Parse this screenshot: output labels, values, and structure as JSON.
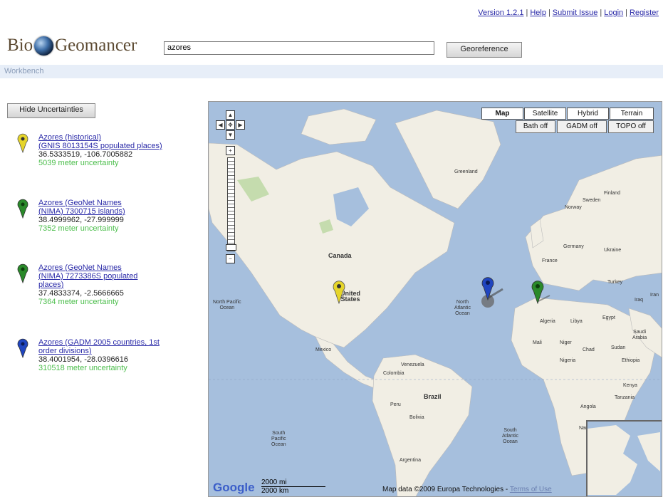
{
  "header": {
    "links": [
      "Version 1.2.1",
      "Help",
      "Submit Issue",
      "Login",
      "Register"
    ],
    "logo_left": "Bio",
    "logo_right": "Geomancer",
    "search_value": "azores",
    "georeference_label": "Georeference"
  },
  "workbench_label": "Workbench",
  "hide_uncertainties_label": "Hide Uncertainties",
  "results": [
    {
      "title_line1": "Azores (historical)",
      "title_line2": "(GNIS 8013154S populated places)",
      "title_line3": "",
      "coords": "36.5333519, -106.7005882",
      "uncertainty": "5039 meter uncertainty",
      "pin_color": "#e6d52a"
    },
    {
      "title_line1": "Azores (GeoNet Names",
      "title_line2": "(NIMA) 7300715 islands)",
      "title_line3": "",
      "coords": "38.4999962, -27.999999",
      "uncertainty": "7352 meter uncertainty",
      "pin_color": "#2a8a2a"
    },
    {
      "title_line1": "Azores (GeoNet Names",
      "title_line2": "(NIMA) 7273386S populated",
      "title_line3": "places)",
      "coords": "37.4833374, -2.5666665",
      "uncertainty": "7364 meter uncertainty",
      "pin_color": "#2a8a2a"
    },
    {
      "title_line1": "Azores (GADM 2005 countries, 1st",
      "title_line2": "order divisions)",
      "title_line3": "",
      "coords": "38.4001954, -28.0396616",
      "uncertainty": "310518 meter uncertainty",
      "pin_color": "#1f45c0"
    }
  ],
  "map": {
    "types": [
      "Map",
      "Satellite",
      "Hybrid",
      "Terrain"
    ],
    "overlays": [
      "Bath off",
      "GADM off",
      "TOPO off"
    ],
    "labels": {
      "greenland": "Greenland",
      "canada": "Canada",
      "united_states": "United\nStates",
      "north_pacific": "North Pacific\nOcean",
      "north_atlantic": "North\nAtlantic\nOcean",
      "brazil": "Brazil",
      "south_pacific": "South\nPacific\nOcean",
      "south_atlantic": "South\nAtlantic\nOcean",
      "argentina": "Argentina",
      "algeria": "Algeria",
      "libya": "Libya",
      "egypt": "Egypt",
      "mali": "Mali",
      "niger": "Niger",
      "chad": "Chad",
      "sudan": "Sudan",
      "nigeria": "Nigeria",
      "ethiopia": "Ethiopia",
      "kenya": "Kenya",
      "tanzania": "Tanzania",
      "angola": "Angola",
      "namibia": "Namibia",
      "venezuela": "Venezuela",
      "colombia": "Colombia",
      "peru": "Peru",
      "bolivia": "Bolivia",
      "france": "France",
      "germany": "Germany",
      "ukraine": "Ukraine",
      "turkey": "Turkey",
      "iran": "Iran",
      "iraq": "Iraq",
      "saudi_arabia": "Saudi\nArabia",
      "mexico": "Mexico",
      "sweden": "Sweden",
      "finland": "Finland",
      "norway": "Norway"
    },
    "scale_mi": "2000 mi",
    "scale_km": "2000 km",
    "attribution": "Map data ©2009 Europa Technologies -",
    "terms": "Terms of Use",
    "google": "Google"
  }
}
